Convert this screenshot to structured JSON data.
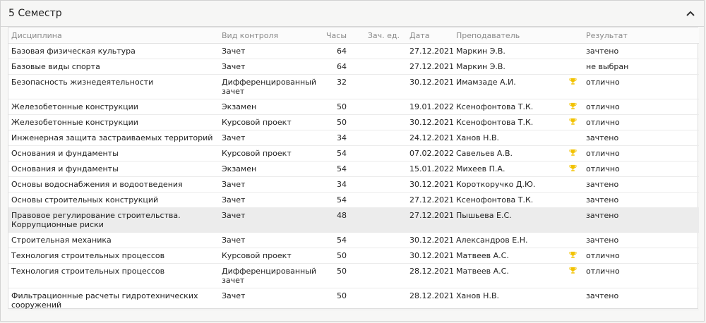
{
  "semester": {
    "title": "5 Семестр"
  },
  "columns": {
    "discipline": "Дисциплина",
    "control": "Вид контроля",
    "hours": "Часы",
    "credits": "Зач. ед.",
    "date": "Дата",
    "teacher": "Преподаватель",
    "result": "Результат"
  },
  "rows": [
    {
      "discipline": "Базовая физическая культура",
      "control": "Зачет",
      "hours": "64",
      "credits": "",
      "date": "27.12.2021",
      "teacher": "Маркин Э.В.",
      "trophy": false,
      "result": "зачтено"
    },
    {
      "discipline": "Базовые виды спорта",
      "control": "Зачет",
      "hours": "64",
      "credits": "",
      "date": "27.12.2021",
      "teacher": "Маркин Э.В.",
      "trophy": false,
      "result": "не выбран"
    },
    {
      "discipline": "Безопасность жизнедеятельности",
      "control": "Дифференцированный зачет",
      "hours": "32",
      "credits": "",
      "date": "30.12.2021",
      "teacher": "Имамзаде А.И.",
      "trophy": true,
      "result": "отлично"
    },
    {
      "discipline": "Железобетонные конструкции",
      "control": "Экзамен",
      "hours": "50",
      "credits": "",
      "date": "19.01.2022",
      "teacher": "Ксенофонтова Т.К.",
      "trophy": true,
      "result": "отлично"
    },
    {
      "discipline": "Железобетонные конструкции",
      "control": "Курсовой проект",
      "hours": "50",
      "credits": "",
      "date": "30.12.2021",
      "teacher": "Ксенофонтова Т.К.",
      "trophy": true,
      "result": "отлично"
    },
    {
      "discipline": "Инженерная защита застраиваемых территорий",
      "control": "Зачет",
      "hours": "34",
      "credits": "",
      "date": "24.12.2021",
      "teacher": "Ханов Н.В.",
      "trophy": false,
      "result": "зачтено"
    },
    {
      "discipline": "Основания и фундаменты",
      "control": "Курсовой проект",
      "hours": "54",
      "credits": "",
      "date": "07.02.2022",
      "teacher": "Савельев А.В.",
      "trophy": true,
      "result": "отлично"
    },
    {
      "discipline": "Основания и фундаменты",
      "control": "Экзамен",
      "hours": "54",
      "credits": "",
      "date": "15.01.2022",
      "teacher": "Михеев П.А.",
      "trophy": true,
      "result": "отлично"
    },
    {
      "discipline": "Основы водоснабжения и водоотведения",
      "control": "Зачет",
      "hours": "34",
      "credits": "",
      "date": "30.12.2021",
      "teacher": "Короткоручко Д.Ю.",
      "trophy": false,
      "result": "зачтено"
    },
    {
      "discipline": "Основы строительных конструкций",
      "control": "Зачет",
      "hours": "54",
      "credits": "",
      "date": "27.12.2021",
      "teacher": "Ксенофонтова Т.К.",
      "trophy": false,
      "result": "зачтено"
    },
    {
      "discipline": "Правовое регулирование строительства. Коррупционные риски",
      "control": "Зачет",
      "hours": "48",
      "credits": "",
      "date": "27.12.2021",
      "teacher": "Пышьева Е.С.",
      "trophy": false,
      "result": "зачтено"
    },
    {
      "discipline": "Строительная механика",
      "control": "Зачет",
      "hours": "54",
      "credits": "",
      "date": "30.12.2021",
      "teacher": "Александров Е.Н.",
      "trophy": false,
      "result": "зачтено"
    },
    {
      "discipline": "Технология строительных процессов",
      "control": "Курсовой проект",
      "hours": "50",
      "credits": "",
      "date": "30.12.2021",
      "teacher": "Матвеев А.С.",
      "trophy": true,
      "result": "отлично"
    },
    {
      "discipline": "Технология строительных процессов",
      "control": "Дифференцированный зачет",
      "hours": "50",
      "credits": "",
      "date": "28.12.2021",
      "teacher": "Матвеев А.С.",
      "trophy": true,
      "result": "отлично"
    },
    {
      "discipline": "Фильтрационные расчеты гидротехнических сооружений",
      "control": "Зачет",
      "hours": "50",
      "credits": "",
      "date": "28.12.2021",
      "teacher": "Ханов Н.В.",
      "trophy": false,
      "result": "зачтено"
    }
  ],
  "icons": {
    "collapse": "chevron-up-icon",
    "trophy": "trophy-icon"
  },
  "colors": {
    "trophy": "#f2c200",
    "highlight_row": "#ececec"
  }
}
